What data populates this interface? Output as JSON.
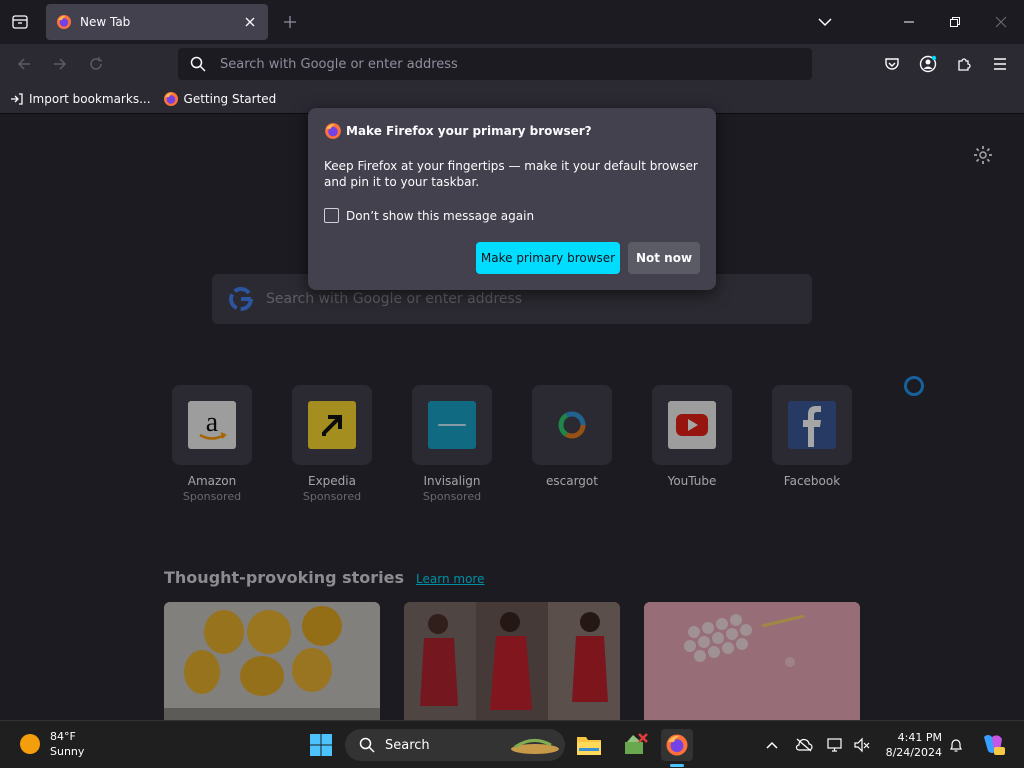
{
  "tab": {
    "title": "New Tab"
  },
  "urlbar": {
    "placeholder": "Search with Google or enter address"
  },
  "bookmarks": [
    {
      "label": "Import bookmarks...",
      "icon": "import-icon"
    },
    {
      "label": "Getting Started",
      "icon": "firefox-icon"
    }
  ],
  "popup": {
    "title": "Make Firefox your primary browser?",
    "body": "Keep Firefox at your fingertips — make it your default browser and pin it to your taskbar.",
    "checkbox_label": "Don’t show this message again",
    "primary_button": "Make primary browser",
    "secondary_button": "Not now"
  },
  "content_search": {
    "placeholder": "Search with Google or enter address"
  },
  "top_sites": [
    {
      "name": "Amazon",
      "sponsor": "Sponsored",
      "icon": "amazon-icon"
    },
    {
      "name": "Expedia",
      "sponsor": "Sponsored",
      "icon": "expedia-icon"
    },
    {
      "name": "Invisalign",
      "sponsor": "Sponsored",
      "icon": "invisalign-icon"
    },
    {
      "name": "escargot",
      "sponsor": "",
      "icon": "escargot-icon"
    },
    {
      "name": "YouTube",
      "sponsor": "",
      "icon": "youtube-icon"
    },
    {
      "name": "Facebook",
      "sponsor": "",
      "icon": "facebook-icon"
    }
  ],
  "stories": {
    "heading": "Thought-provoking stories",
    "link": "Learn more"
  },
  "taskbar": {
    "weather_temp": "84°F",
    "weather_desc": "Sunny",
    "search_label": "Search",
    "time": "4:41 PM",
    "date": "8/24/2024"
  },
  "colors": {
    "accent": "#00ddff",
    "popup_bg": "#42414d",
    "chrome_bg": "#2b2a33"
  }
}
